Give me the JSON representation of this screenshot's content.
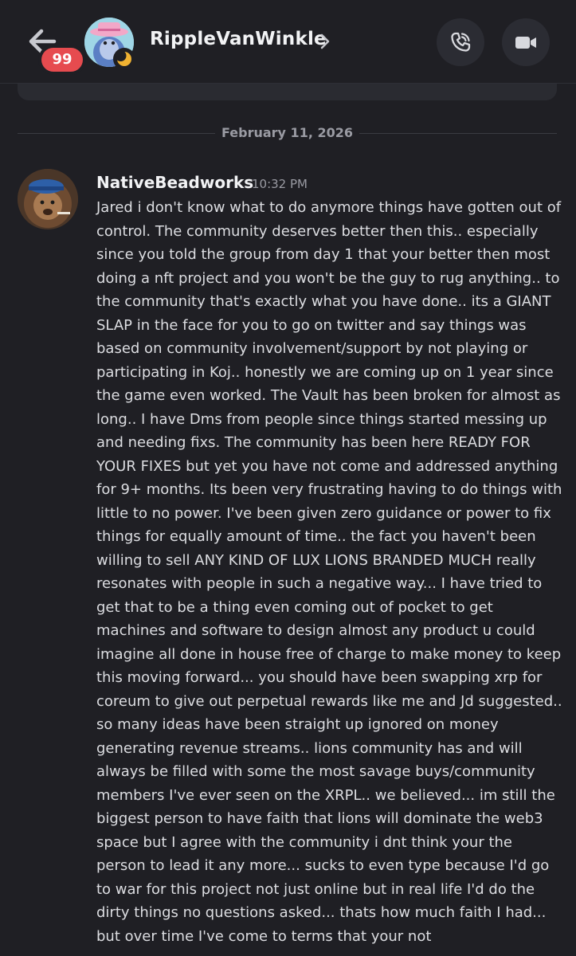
{
  "header": {
    "title": "RippleVanWinkle",
    "badge_count": "99",
    "icons": {
      "back": "arrow-left-icon",
      "chevron": "chevron-right-icon",
      "call": "phone-icon",
      "video": "video-camera-icon"
    }
  },
  "divider": {
    "date": "February 11, 2026"
  },
  "message": {
    "author": "NativeBeadworks",
    "time": "10:32 PM",
    "text": "Jared i don't know what to do anymore things have gotten out of control. The community deserves better then this.. especially since you told the group from day 1 that your better then most doing a nft project and you won't be the guy to rug anything.. to the community that's exactly what you have done.. its a GIANT SLAP in the face for you to go on twitter and  say things was based on community involvement/support by not playing or participating in Koj.. honestly we are coming up on 1 year since the game even worked. The Vault has been broken for almost as long.. I have Dms from people since things started messing up and needing fixs. The community has been here READY FOR YOUR FIXES but yet you have not come and addressed anything for 9+ months. Its been very frustrating having to do things with little to no power. I've been given zero guidance or power to fix things for equally amount of time.. the fact you haven't been willing to sell ANY KIND OF LUX LIONS BRANDED MUCH really resonates with people in such a negative way... I have tried to get that to be a thing even coming out of pocket to get machines and software to design almost any product u could imagine all done in house free of charge to make money to keep this moving forward... you should have been swapping xrp for coreum to give out perpetual rewards like me and Jd suggested.. so many ideas have been straight up ignored on money generating revenue streams.. lions community has and will always be filled with some the most savage buys/community members I've ever seen on the XRPL.. we believed... im still the biggest person to have faith that lions will dominate the web3 space but I agree with the community i dnt think your the person to lead it any more... sucks to even type because I'd go to war for this project not just online but in real life I'd do the dirty things no questions asked... thats how much faith I had... but over time I've come to terms that your not"
  },
  "colors": {
    "background": "#1f1f24",
    "badge": "#e64b4f",
    "text": "#dcdde1",
    "muted": "#9a9ba3",
    "button_bg": "#2b2c33"
  }
}
